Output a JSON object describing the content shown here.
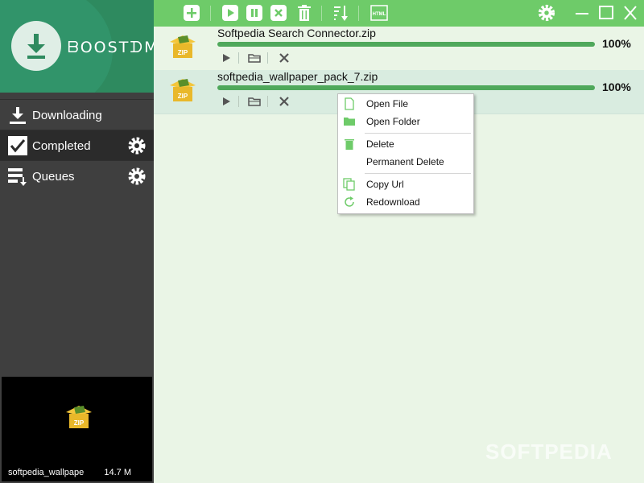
{
  "app": {
    "logo_text": "ᗷOOSTᗪM"
  },
  "colors": {
    "accent": "#6ecb69",
    "progress": "#4fa85b",
    "sidebar": "#3f3f3f",
    "logo_bg": "#2e8a5f"
  },
  "toolbar": {
    "buttons": [
      "add-icon",
      "play-icon",
      "pause-icon",
      "stop-icon",
      "trash-icon",
      "sort-icon",
      "html-icon",
      "settings-icon",
      "minimize-icon",
      "maximize-icon",
      "close-icon"
    ],
    "html_label": "HTML"
  },
  "sidebar": {
    "items": [
      {
        "label": "Downloading",
        "icon": "download-icon",
        "active": false
      },
      {
        "label": "Completed",
        "icon": "checkbox-icon",
        "active": true
      },
      {
        "label": "Queues",
        "icon": "queue-icon",
        "active": false
      }
    ],
    "preview": {
      "name": "softpedia_wallpape",
      "size": "14.7 M"
    }
  },
  "downloads": [
    {
      "name": "Softpedia Search Connector.zip",
      "progress": "100%",
      "fraction": 1.0
    },
    {
      "name": "softpedia_wallpaper_pack_7.zip",
      "progress": "100%",
      "fraction": 1.0
    }
  ],
  "context_menu": {
    "items": [
      "Open File",
      "Open Folder",
      "Delete",
      "Permanent Delete",
      "Copy Url",
      "Redownload"
    ]
  },
  "watermark": "SOFTPEDIA"
}
